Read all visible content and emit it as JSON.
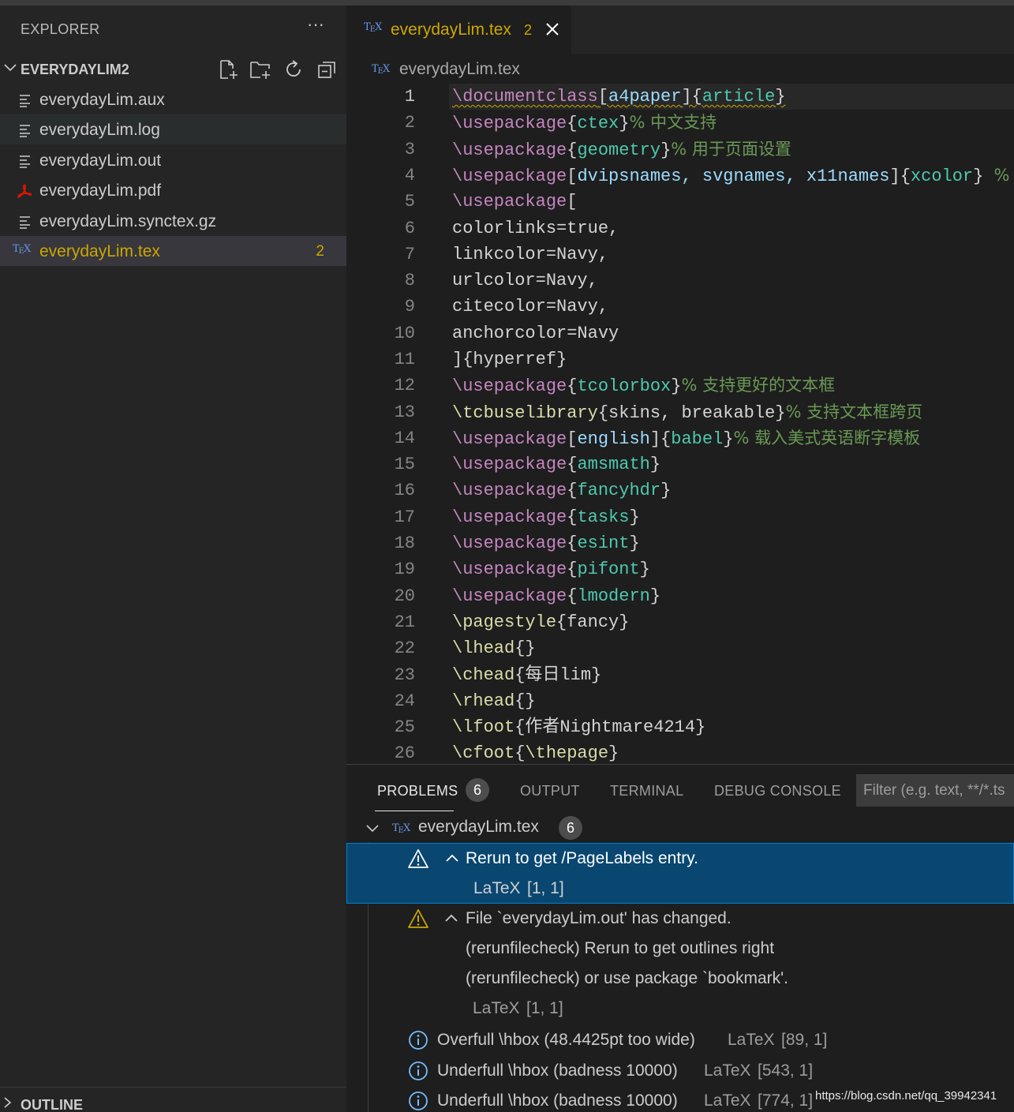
{
  "sidebar": {
    "title": "EXPLORER",
    "more": "···",
    "folder": {
      "name": "EVERYDAYLIM2"
    },
    "files": [
      {
        "name": "everydayLim.aux",
        "icon": "lines-icon",
        "state": "normal"
      },
      {
        "name": "everydayLim.log",
        "icon": "lines-icon",
        "state": "hover"
      },
      {
        "name": "everydayLim.out",
        "icon": "lines-icon",
        "state": "normal"
      },
      {
        "name": "everydayLim.pdf",
        "icon": "pdf-icon",
        "state": "normal"
      },
      {
        "name": "everydayLim.synctex.gz",
        "icon": "lines-icon",
        "state": "normal"
      },
      {
        "name": "everydayLim.tex",
        "icon": "tex-icon",
        "state": "active",
        "badge": "2"
      }
    ],
    "outline": "OUTLINE"
  },
  "tab": {
    "label": "everydayLim.tex",
    "count": "2"
  },
  "breadcrumb": {
    "label": "everydayLim.tex"
  },
  "tex_icon": {
    "text": "T",
    "sub": "E",
    "tail": "X"
  },
  "editor": {
    "current_line": 1,
    "lines": [
      [
        [
          "\\documentclass",
          "kw"
        ],
        [
          "[",
          "p"
        ],
        [
          "a4paper",
          "opt"
        ],
        [
          "]{",
          "p"
        ],
        [
          "article",
          "arg"
        ],
        [
          "}",
          "p"
        ]
      ],
      [
        [
          "\\usepackage",
          "kw"
        ],
        [
          "{",
          "p"
        ],
        [
          "ctex",
          "arg"
        ],
        [
          "}",
          "p"
        ],
        [
          "% 中文支持",
          "cmt"
        ]
      ],
      [
        [
          "\\usepackage",
          "kw"
        ],
        [
          "{",
          "p"
        ],
        [
          "geometry",
          "arg"
        ],
        [
          "}",
          "p"
        ],
        [
          "% 用于页面设置",
          "cmt"
        ]
      ],
      [
        [
          "\\usepackage",
          "kw"
        ],
        [
          "[",
          "p"
        ],
        [
          "dvipsnames, svgnames, x11names",
          "opt"
        ],
        [
          "]{",
          "p"
        ],
        [
          "xcolor",
          "arg"
        ],
        [
          "} ",
          "p"
        ],
        [
          "%",
          "cmt"
        ]
      ],
      [
        [
          "\\usepackage",
          "kw"
        ],
        [
          "[",
          "p"
        ]
      ],
      [
        [
          "colorlinks=true,",
          "p"
        ]
      ],
      [
        [
          "linkcolor=Navy,",
          "p"
        ]
      ],
      [
        [
          "urlcolor=Navy,",
          "p"
        ]
      ],
      [
        [
          "citecolor=Navy,",
          "p"
        ]
      ],
      [
        [
          "anchorcolor=Navy",
          "p"
        ]
      ],
      [
        [
          "]{hyperref}",
          "p"
        ]
      ],
      [
        [
          "\\usepackage",
          "kw"
        ],
        [
          "{",
          "p"
        ],
        [
          "tcolorbox",
          "arg"
        ],
        [
          "}",
          "p"
        ],
        [
          "% 支持更好的文本框",
          "cmt"
        ]
      ],
      [
        [
          "\\tcbuselibrary",
          "fn"
        ],
        [
          "{skins, breakable}",
          "p"
        ],
        [
          "% 支持文本框跨页",
          "cmt"
        ]
      ],
      [
        [
          "\\usepackage",
          "kw"
        ],
        [
          "[",
          "p"
        ],
        [
          "english",
          "opt"
        ],
        [
          "]{",
          "p"
        ],
        [
          "babel",
          "arg"
        ],
        [
          "}",
          "p"
        ],
        [
          "% 载入美式英语断字模板",
          "cmt"
        ]
      ],
      [
        [
          "\\usepackage",
          "kw"
        ],
        [
          "{",
          "p"
        ],
        [
          "amsmath",
          "arg"
        ],
        [
          "}",
          "p"
        ]
      ],
      [
        [
          "\\usepackage",
          "kw"
        ],
        [
          "{",
          "p"
        ],
        [
          "fancyhdr",
          "arg"
        ],
        [
          "}",
          "p"
        ]
      ],
      [
        [
          "\\usepackage",
          "kw"
        ],
        [
          "{",
          "p"
        ],
        [
          "tasks",
          "arg"
        ],
        [
          "}",
          "p"
        ]
      ],
      [
        [
          "\\usepackage",
          "kw"
        ],
        [
          "{",
          "p"
        ],
        [
          "esint",
          "arg"
        ],
        [
          "}",
          "p"
        ]
      ],
      [
        [
          "\\usepackage",
          "kw"
        ],
        [
          "{",
          "p"
        ],
        [
          "pifont",
          "arg"
        ],
        [
          "}",
          "p"
        ]
      ],
      [
        [
          "\\usepackage",
          "kw"
        ],
        [
          "{",
          "p"
        ],
        [
          "lmodern",
          "arg"
        ],
        [
          "}",
          "p"
        ]
      ],
      [
        [
          "\\pagestyle",
          "fn"
        ],
        [
          "{fancy}",
          "p"
        ]
      ],
      [
        [
          "\\lhead",
          "fn"
        ],
        [
          "{}",
          "p"
        ]
      ],
      [
        [
          "\\chead",
          "fn"
        ],
        [
          "{每日lim}",
          "p"
        ]
      ],
      [
        [
          "\\rhead",
          "fn"
        ],
        [
          "{}",
          "p"
        ]
      ],
      [
        [
          "\\lfoot",
          "fn"
        ],
        [
          "{作者Nightmare4214}",
          "p"
        ]
      ],
      [
        [
          "\\cfoot",
          "fn"
        ],
        [
          "{",
          "p"
        ],
        [
          "\\thepage",
          "fn"
        ],
        [
          "}",
          "p"
        ]
      ]
    ]
  },
  "panel": {
    "tabs": {
      "problems": "PROBLEMS",
      "output": "OUTPUT",
      "terminal": "TERMINAL",
      "debug": "DEBUG CONSOLE"
    },
    "problems_count": "6",
    "filter_placeholder": "Filter (e.g. text, **/*.ts",
    "file": {
      "name": "everydayLim.tex",
      "count": "6"
    },
    "problems": [
      {
        "severity": "warning",
        "lines": [
          "Rerun to get /PageLabels entry."
        ],
        "source": "LaTeX",
        "location": "[1, 1]",
        "selected": true
      },
      {
        "severity": "warning",
        "lines": [
          "File `everydayLim.out' has changed.",
          "(rerunfilecheck) Rerun to get outlines right",
          "(rerunfilecheck) or use package `bookmark'."
        ],
        "source": "LaTeX",
        "location": "[1, 1]"
      },
      {
        "severity": "info",
        "lines": [
          "Overfull \\hbox (48.4425pt too wide)"
        ],
        "source": "LaTeX",
        "location": "[89, 1]"
      },
      {
        "severity": "info",
        "lines": [
          "Underfull \\hbox (badness 10000)"
        ],
        "source": "LaTeX",
        "location": "[543, 1]"
      },
      {
        "severity": "info",
        "lines": [
          "Underfull \\hbox (badness 10000)"
        ],
        "source": "LaTeX",
        "location": "[774, 1]"
      }
    ]
  },
  "watermark": "https://blog.csdn.net/qq_39942341",
  "colors": {
    "warning": "#cca700",
    "info": "#75beff",
    "selection": "#094771",
    "pdf": "#e51400"
  }
}
